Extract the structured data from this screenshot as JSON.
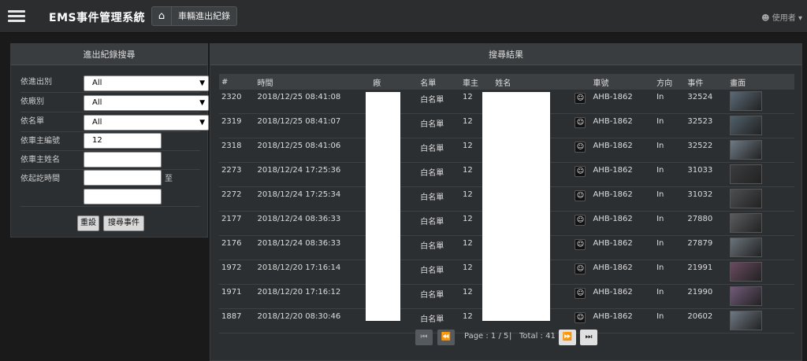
{
  "header": {
    "title": "EMS事件管理系統",
    "breadcrumb": "車輛進出紀錄",
    "user": "使用者"
  },
  "search": {
    "title": "進出紀錄搜尋",
    "fields": [
      {
        "label": "依進出別",
        "value": "All"
      },
      {
        "label": "依廠別",
        "value": "All"
      },
      {
        "label": "依名單",
        "value": "All"
      },
      {
        "label": "依車主編號",
        "value": "12"
      },
      {
        "label": "依車主姓名",
        "value": ""
      },
      {
        "label": "依起訖時間",
        "value": ""
      }
    ],
    "to_label": "至",
    "reset_label": "重設",
    "search_label": "搜尋事件"
  },
  "results": {
    "title": "搜尋結果",
    "columns": [
      "#",
      "時間",
      "廠",
      "名單",
      "車主",
      "姓名",
      "車號",
      "方向",
      "事件",
      "畫面"
    ],
    "rows": [
      [
        "2320",
        "2018/12/25 08:41:08",
        "白名單",
        "12",
        "AHB-1862",
        "In",
        "32524"
      ],
      [
        "2319",
        "2018/12/25 08:41:07",
        "白名單",
        "12",
        "AHB-1862",
        "In",
        "32523"
      ],
      [
        "2318",
        "2018/12/25 08:41:06",
        "白名單",
        "12",
        "AHB-1862",
        "In",
        "32522"
      ],
      [
        "2273",
        "2018/12/24 17:25:36",
        "白名單",
        "12",
        "AHB-1862",
        "In",
        "31033"
      ],
      [
        "2272",
        "2018/12/24 17:25:34",
        "白名單",
        "12",
        "AHB-1862",
        "In",
        "31032"
      ],
      [
        "2177",
        "2018/12/24 08:36:33",
        "白名單",
        "12",
        "AHB-1862",
        "In",
        "27880"
      ],
      [
        "2176",
        "2018/12/24 08:36:33",
        "白名單",
        "12",
        "AHB-1862",
        "In",
        "27879"
      ],
      [
        "1972",
        "2018/12/20 17:16:14",
        "白名單",
        "12",
        "AHB-1862",
        "In",
        "21991"
      ],
      [
        "1971",
        "2018/12/20 17:16:12",
        "白名單",
        "12",
        "AHB-1862",
        "In",
        "21990"
      ],
      [
        "1887",
        "2018/12/20 08:30:46",
        "白名單",
        "12",
        "AHB-1862",
        "In",
        "20602"
      ]
    ],
    "thumb_colors": [
      "#5b6a78",
      "#50606a",
      "#6e7a86",
      "#3a3c3e",
      "#4c4f52",
      "#5a5c5e",
      "#6a747a",
      "#6b4a60",
      "#725a7a",
      "#6e7884"
    ]
  },
  "pager": {
    "page_text": "Page : 1 / 5",
    "sep": "|",
    "total_text": "Total : 41"
  }
}
